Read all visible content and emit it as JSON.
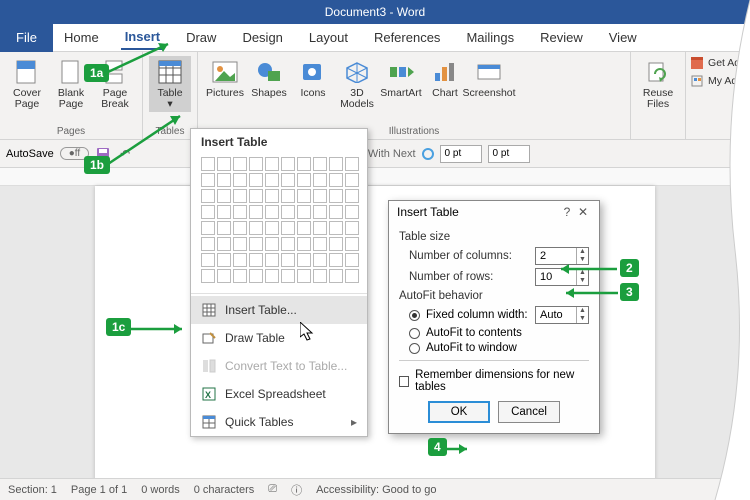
{
  "title": "Document3  -  Word",
  "tabs": {
    "file": "File",
    "home": "Home",
    "insert": "Insert",
    "draw": "Draw",
    "design": "Design",
    "layout": "Layout",
    "references": "References",
    "mailings": "Mailings",
    "review": "Review",
    "view": "View"
  },
  "ribbon": {
    "pages": {
      "label": "Pages",
      "cover": "Cover\nPage",
      "blank": "Blank\nPage",
      "break": "Page\nBreak"
    },
    "tables": {
      "label": "Tables",
      "table": "Table"
    },
    "illustrations": {
      "label": "Illustrations",
      "pictures": "Pictures",
      "shapes": "Shapes",
      "icons": "Icons",
      "models": "3D\nModels",
      "smartart": "SmartArt",
      "chart": "Chart",
      "screenshot": "Screenshot"
    },
    "reuse": {
      "files": "Reuse\nFiles"
    },
    "addins": {
      "get": "Get Add",
      "my": "My Ad"
    }
  },
  "qat": {
    "autosave": "AutoSave",
    "kwn": "Keep With Next",
    "pt1": "0 pt",
    "pt2": "0 pt"
  },
  "dropdown": {
    "header": "Insert Table",
    "insert": "Insert Table...",
    "draw": "Draw Table",
    "convert": "Convert Text to Table...",
    "excel": "Excel Spreadsheet",
    "quick": "Quick Tables"
  },
  "dialog": {
    "title": "Insert Table",
    "size_hdr": "Table size",
    "cols_label": "Number of columns:",
    "rows_label": "Number of rows:",
    "cols_val": "2",
    "rows_val": "10",
    "autofit_hdr": "AutoFit behavior",
    "fixed": "Fixed column width:",
    "fixed_val": "Auto",
    "contents": "AutoFit to contents",
    "window": "AutoFit to window",
    "remember": "Remember dimensions for new tables",
    "ok": "OK",
    "cancel": "Cancel"
  },
  "status": {
    "section": "Section: 1",
    "page": "Page 1 of 1",
    "words": "0 words",
    "chars": "0 characters",
    "access": "Accessibility: Good to go"
  },
  "callouts": {
    "a": "1a",
    "b": "1b",
    "c": "1c",
    "two": "2",
    "three": "3",
    "four": "4"
  }
}
